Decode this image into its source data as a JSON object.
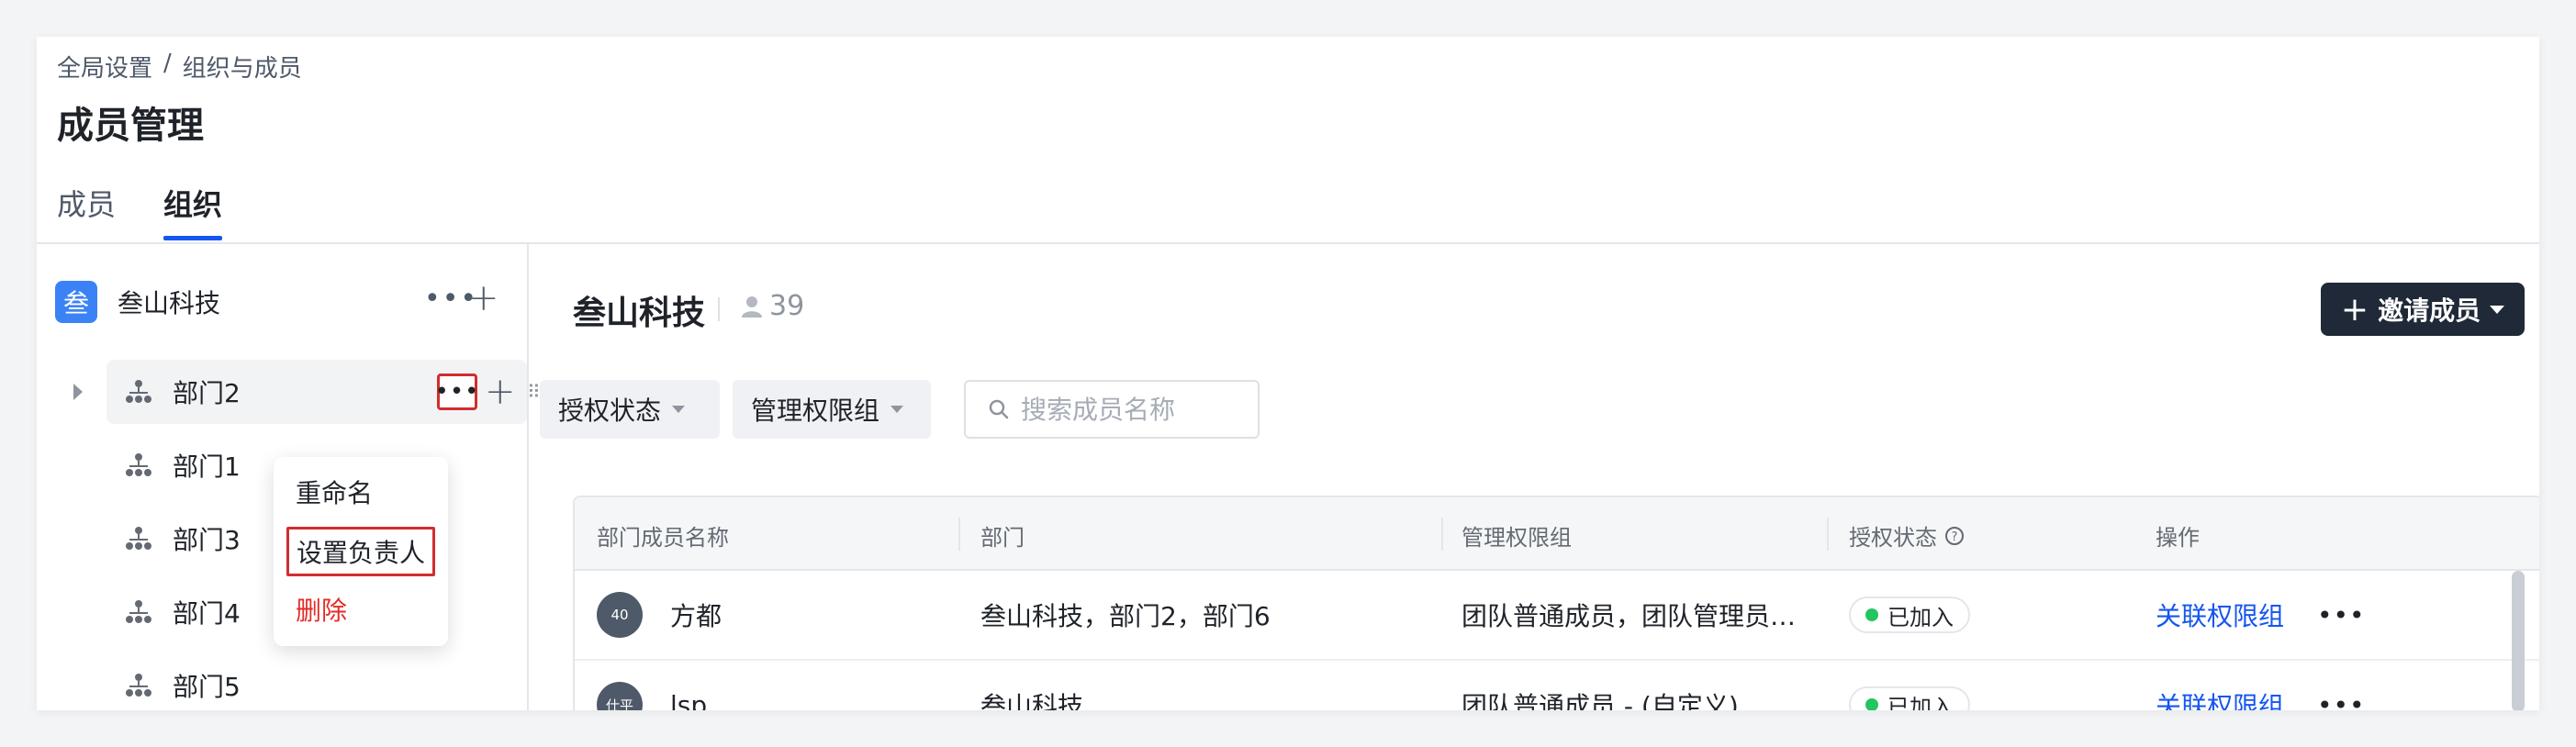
{
  "breadcrumb": {
    "root": "全局设置",
    "separator": "/",
    "current": "组织与成员"
  },
  "page_title": "成员管理",
  "tabs": [
    {
      "label": "成员",
      "active": false
    },
    {
      "label": "组织",
      "active": true
    }
  ],
  "sidebar": {
    "org": {
      "logo_text": "叁",
      "name": "叁山科技"
    },
    "departments": [
      {
        "label": "部门2",
        "expanded": false
      },
      {
        "label": "部门1"
      },
      {
        "label": "部门3"
      },
      {
        "label": "部门4"
      },
      {
        "label": "部门5"
      }
    ],
    "context_menu": {
      "items": [
        {
          "label": "重命名"
        },
        {
          "label": "设置负责人"
        },
        {
          "label": "删除"
        }
      ]
    }
  },
  "main": {
    "title": "叁山科技",
    "member_count": "39",
    "invite_label": "邀请成员",
    "filters": [
      {
        "label": "授权状态"
      },
      {
        "label": "管理权限组"
      }
    ],
    "search_placeholder": "搜索成员名称",
    "table": {
      "columns": [
        "部门成员名称",
        "部门",
        "管理权限组",
        "授权状态",
        "操作"
      ],
      "rows": [
        {
          "avatar": "40",
          "name": "方都",
          "department": "叁山科技，部门2，部门6",
          "group": "团队普通成员，团队管理员…",
          "status": "已加入",
          "action": "关联权限组"
        },
        {
          "avatar": "仕平",
          "name": "lsp",
          "department": "叁山科技",
          "group": "团队普通成员 - (自定义)",
          "status": "已加入",
          "action": "关联权限组"
        }
      ]
    }
  },
  "colors": {
    "accent": "#1456f0",
    "invite_button": "#1f2937",
    "danger": "#e22e28",
    "status_joined": "#22c55e",
    "highlight_box": "#d22d2d"
  },
  "icons": [
    "more-icon",
    "plus-icon",
    "org-tree-icon",
    "caret-right-icon",
    "drag-handle-icon",
    "user-icon",
    "chevron-down-icon",
    "search-icon",
    "help-icon"
  ]
}
